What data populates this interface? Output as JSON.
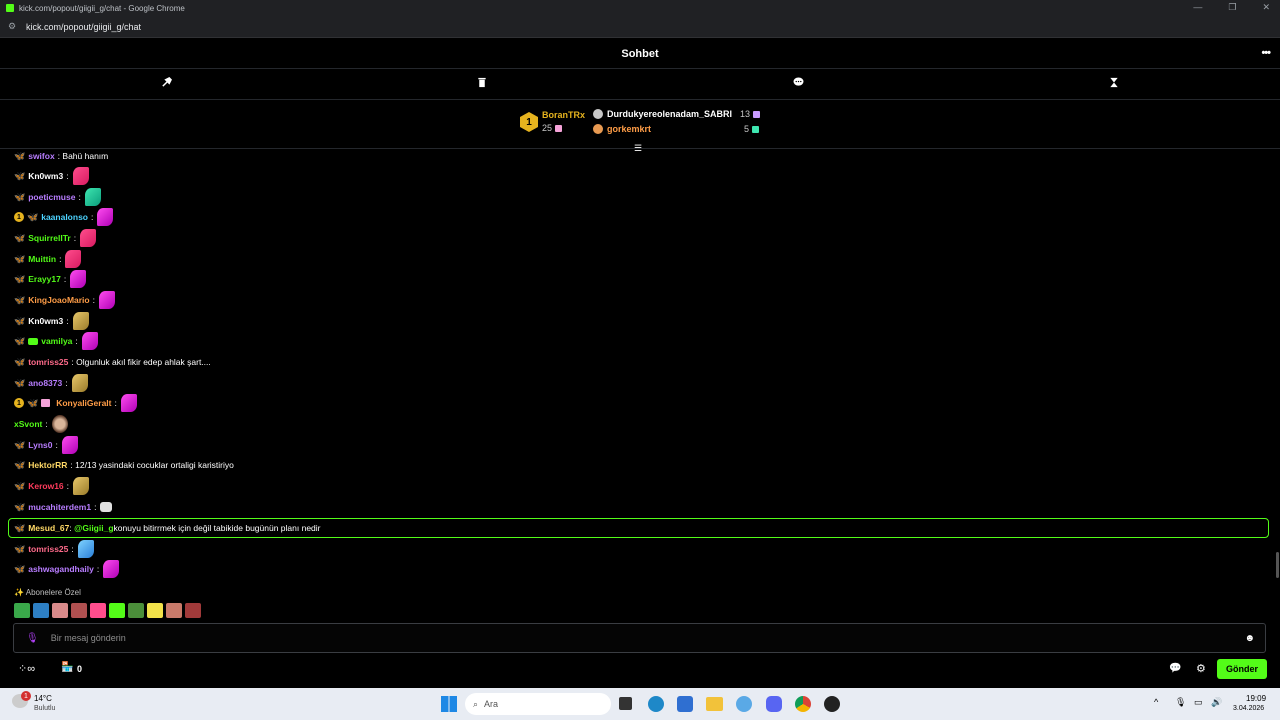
{
  "window": {
    "title": "kick.com/popout/giigii_g/chat - Google Chrome",
    "url": "kick.com/popout/giigii_g/chat"
  },
  "chat": {
    "title": "Sohbet",
    "leaderboard": {
      "rank_number": "1",
      "first": {
        "name": "BoranTRx",
        "count": "25"
      },
      "second": {
        "name": "Durdukyereolenadam_SABRI",
        "count": "13"
      },
      "third": {
        "name": "gorkemkrt",
        "count": "5"
      }
    },
    "messages": [
      {
        "user": "swifox",
        "text": ": Bahü hanım",
        "color": "#b87dff"
      },
      {
        "user": "Kn0wm3",
        "text": ":",
        "color": "#ffffff"
      },
      {
        "user": "poeticmuse",
        "text": ":",
        "color": "#b87dff"
      },
      {
        "user": "kaanalonso",
        "text": ":",
        "color": "#4cd3ff"
      },
      {
        "user": "SquirrelITr",
        "text": ":",
        "color": "#53fc18"
      },
      {
        "user": "Muittin",
        "text": ":",
        "color": "#53fc18"
      },
      {
        "user": "Erayy17",
        "text": ":",
        "color": "#53fc18"
      },
      {
        "user": "KingJoaoMario",
        "text": ":",
        "color": "#ff9d47"
      },
      {
        "user": "Kn0wm3",
        "text": ":",
        "color": "#ffffff"
      },
      {
        "user": "vamilya",
        "text": ":",
        "color": "#53fc18"
      },
      {
        "user": "tomriss25",
        "text": ": Olgunluk akıl fikir edep ahlak şart....",
        "color": "#ff6b8b"
      },
      {
        "user": "ano8373",
        "text": ":",
        "color": "#b87dff"
      },
      {
        "user": "KonyaliGeralt",
        "text": ":",
        "color": "#ff9d47"
      },
      {
        "user": "xSvont",
        "text": ":",
        "color": "#53fc18"
      },
      {
        "user": "Lyns0",
        "text": ":",
        "color": "#b87dff"
      },
      {
        "user": "HektorRR",
        "text": ": 12/13 yasindaki cocuklar ortaligi karistiriyo",
        "color": "#ffd966"
      },
      {
        "user": "Kerow16",
        "text": ":",
        "color": "#ff3b5c"
      },
      {
        "user": "mucahiterdem1",
        "text": ":",
        "color": "#b87dff"
      },
      {
        "user": "Mesud_67",
        "mention": "@Giigii_g",
        "text": " konuyu bitirrmek için değil tabikide bugünün planı nedir",
        "color": "#ffd966"
      },
      {
        "user": "tomriss25",
        "text": ":",
        "color": "#ff6b8b"
      },
      {
        "user": "ashwagandhaily",
        "text": ":",
        "color": "#b87dff"
      }
    ],
    "subs_label": "Abonelere Özel",
    "input": {
      "placeholder": "Bir mesaj gönderin"
    },
    "bottom": {
      "count": "0",
      "send_label": "Gönder"
    }
  },
  "taskbar": {
    "weather_temp": "14°C",
    "weather_desc": "Bulutlu",
    "search_placeholder": "Ara",
    "time": "19:09",
    "date": "3.04.2026",
    "notification_count": "1"
  }
}
